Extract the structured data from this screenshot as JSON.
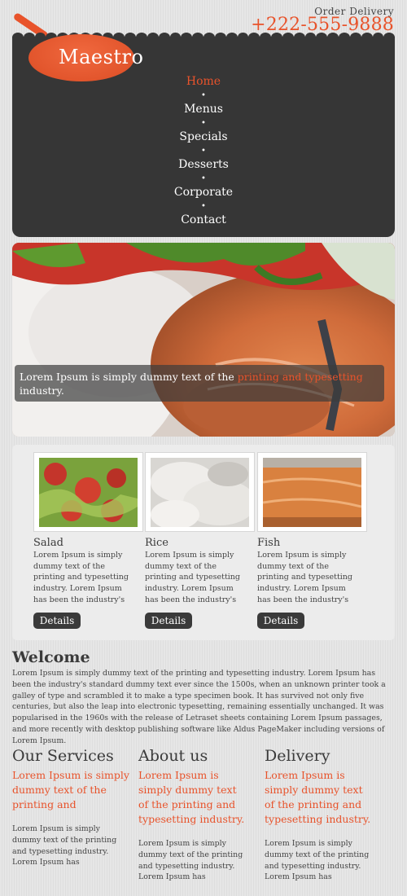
{
  "contact": {
    "order_label": "Order Delivery",
    "phone": "+222-555-9888"
  },
  "brand": {
    "name": "Maestro"
  },
  "nav": {
    "items": [
      {
        "label": "Home",
        "active": true
      },
      {
        "label": "Menus"
      },
      {
        "label": "Specials"
      },
      {
        "label": "Desserts"
      },
      {
        "label": "Corporate"
      },
      {
        "label": "Contact"
      }
    ],
    "separator": "•"
  },
  "hero": {
    "caption_start": "Lorem Ipsum is simply dummy text of the ",
    "caption_highlight": "printing and typesetting",
    "caption_end": " industry."
  },
  "products": [
    {
      "title": "Salad",
      "text": "Lorem Ipsum is simply dummy text of the printing and typesetting industry. Lorem Ipsum has been the industry's standard dummy text",
      "button": "Details"
    },
    {
      "title": "Rice",
      "text": "Lorem Ipsum is simply dummy text of the printing and typesetting industry. Lorem Ipsum has been the industry's standard dummy text",
      "button": "Details"
    },
    {
      "title": "Fish",
      "text": "Lorem Ipsum is simply dummy text of the printing and typesetting industry. Lorem Ipsum has been the industry's standard dummy text",
      "button": "Details"
    }
  ],
  "welcome": {
    "title": "Welcome",
    "text": "Lorem Ipsum is simply dummy text of the printing and typesetting industry. Lorem Ipsum has been the industry's standard dummy text ever since the 1500s, when an unknown printer took a galley of type and scrambled it to make a type specimen book. It has survived not only five centuries, but also the leap into electronic typesetting, remaining essentially unchanged. It was popularised in the 1960s with the release of Letraset sheets containing Lorem Ipsum passages, and more recently with desktop publishing software like Aldus PageMaker including versions of Lorem Ipsum."
  },
  "columns": [
    {
      "title": "Our Services",
      "lead": "Lorem Ipsum is simply dummy text of the printing and",
      "body": "Lorem Ipsum is simply dummy text of the printing and typesetting industry. Lorem Ipsum has"
    },
    {
      "title": "About us",
      "lead": "Lorem Ipsum is simply dummy text of the printing and typesetting industry.",
      "body": "Lorem Ipsum is simply dummy text of the printing and typesetting industry. Lorem Ipsum has"
    },
    {
      "title": "Delivery",
      "lead": "Lorem Ipsum is simply dummy text of the printing and typesetting industry.",
      "body": "Lorem Ipsum is simply dummy text of the printing and typesetting industry. Lorem Ipsum has"
    }
  ],
  "colors": {
    "accent": "#e8532b",
    "panel": "#363636",
    "background": "#e4e4e4"
  }
}
